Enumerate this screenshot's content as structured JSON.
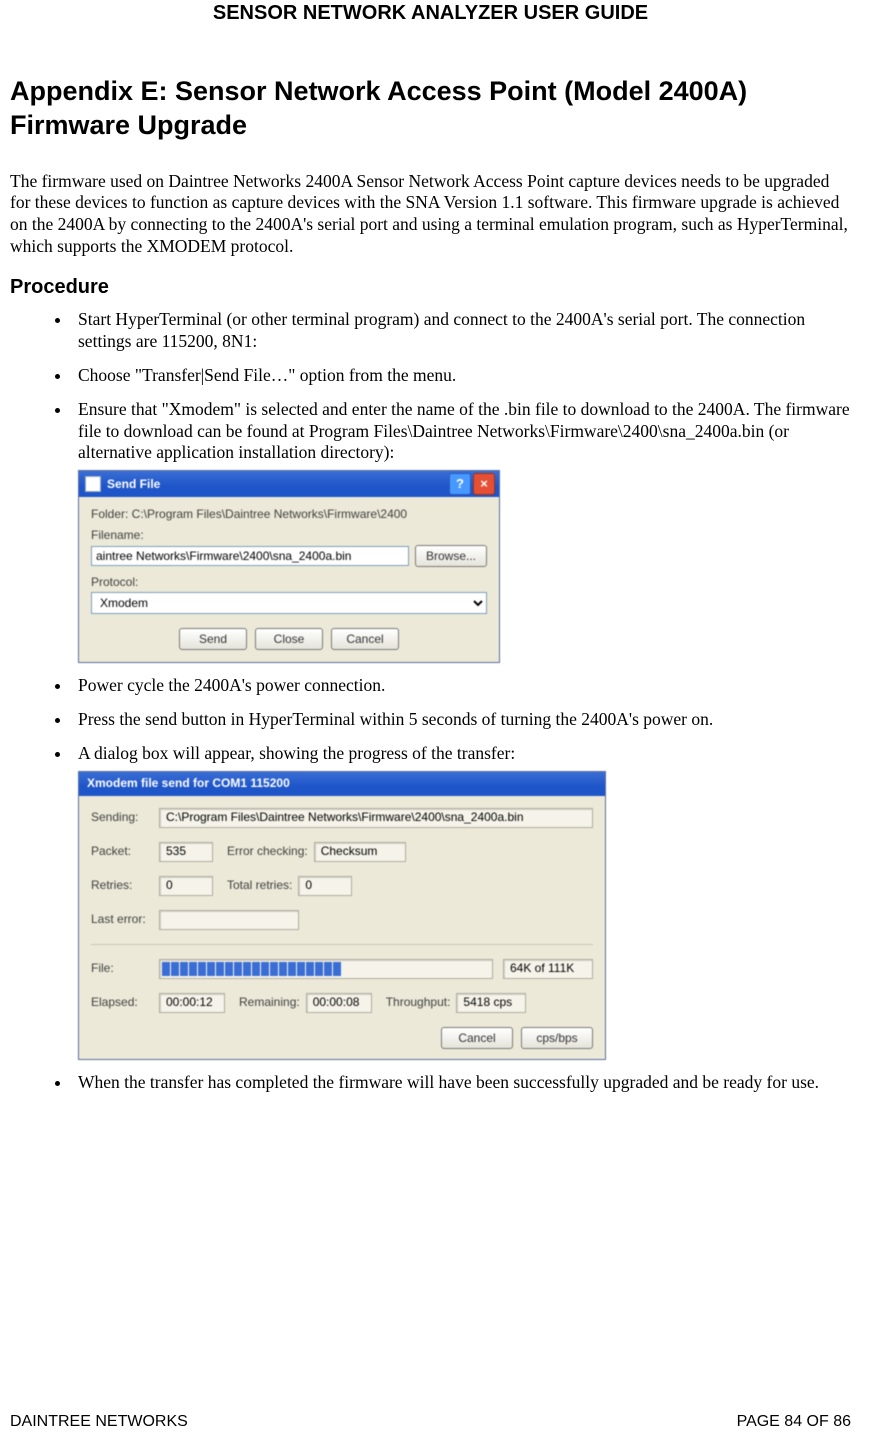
{
  "doc_header": "SENSOR NETWORK ANALYZER USER GUIDE",
  "appendix_title": "Appendix E: Sensor Network Access Point (Model 2400A) Firmware Upgrade",
  "intro": "The firmware used on Daintree Networks 2400A Sensor Network Access Point capture devices needs to be upgraded for these devices to function as capture devices with the SNA Version 1.1 software. This firmware upgrade is achieved on the 2400A by connecting to the 2400A's serial port and using a terminal emulation program, such as HyperTerminal, which supports the XMODEM protocol.",
  "procedure_heading": "Procedure",
  "steps": {
    "s1": "Start HyperTerminal (or other terminal program) and connect to the 2400A's serial port. The connection settings are 115200, 8N1:",
    "s2": "Choose \"Transfer|Send File…\" option from the menu.",
    "s3": "Ensure that \"Xmodem\" is selected and enter the name of the .bin file to download to the 2400A. The firmware file to download can be found at Program Files\\Daintree Networks\\Firmware\\2400\\sna_2400a.bin (or alternative application installation directory):",
    "s4": "Power cycle the 2400A's power connection.",
    "s5": "Press the send button in HyperTerminal within 5 seconds of turning the 2400A's power on.",
    "s6": "A dialog box will appear, showing the progress of the transfer:",
    "s7": "When the transfer has completed the firmware will have been successfully upgraded and be ready for use."
  },
  "send_file_dialog": {
    "title": "Send File",
    "folder_label": "Folder:  C:\\Program Files\\Daintree Networks\\Firmware\\2400",
    "filename_label": "Filename:",
    "filename_value": "aintree Networks\\Firmware\\2400\\sna_2400a.bin",
    "browse": "Browse...",
    "protocol_label": "Protocol:",
    "protocol_value": "Xmodem",
    "send": "Send",
    "close": "Close",
    "cancel": "Cancel"
  },
  "xmodem_dialog": {
    "title": "Xmodem file send for COM1 115200",
    "sending_label": "Sending:",
    "sending_value": "C:\\Program Files\\Daintree Networks\\Firmware\\2400\\sna_2400a.bin",
    "packet_label": "Packet:",
    "packet_value": "535",
    "error_checking_label": "Error checking:",
    "error_checking_value": "Checksum",
    "retries_label": "Retries:",
    "retries_value": "0",
    "total_retries_label": "Total retries:",
    "total_retries_value": "0",
    "last_error_label": "Last error:",
    "last_error_value": "",
    "file_label": "File:",
    "file_size": "64K of 111K",
    "elapsed_label": "Elapsed:",
    "elapsed_value": "00:00:12",
    "remaining_label": "Remaining:",
    "remaining_value": "00:00:08",
    "throughput_label": "Throughput:",
    "throughput_value": "5418 cps",
    "cancel": "Cancel",
    "cpsbps": "cps/bps"
  },
  "footer": {
    "left": "DAINTREE NETWORKS",
    "right": "PAGE 84 OF 86"
  }
}
